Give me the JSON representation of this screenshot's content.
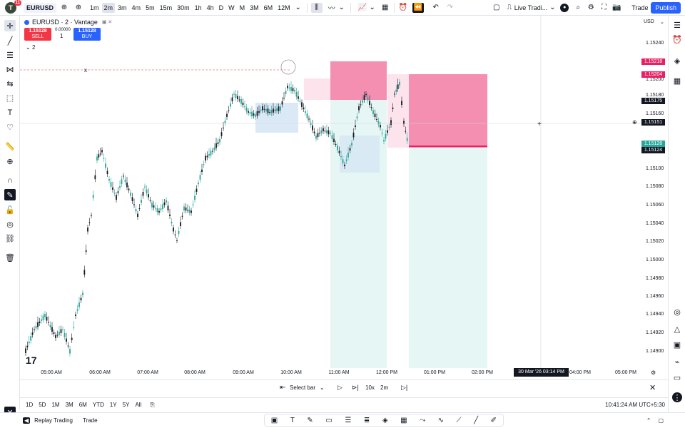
{
  "header": {
    "user_initial": "T",
    "notifications": "11",
    "symbol": "EURUSD",
    "intervals": [
      "1m",
      "2m",
      "3m",
      "4m",
      "5m",
      "15m",
      "30m",
      "1h",
      "4h",
      "D",
      "W",
      "M",
      "3M",
      "6M",
      "12M"
    ],
    "active_interval": "2m",
    "trading_label": "Live Tradi...",
    "trade_label": "Trade",
    "publish_label": "Publish"
  },
  "legend": {
    "symbol_line": "EURUSD · 2 · Vantage",
    "sell_price": "1.15128",
    "sell_label": "SELL",
    "buy_price": "1.15128",
    "buy_label": "BUY",
    "spread": "0.00000",
    "quantity": "1",
    "indicators_count": "2"
  },
  "axis": {
    "currency": "USD",
    "labels": [
      "1.15240",
      "1.15200",
      "1.15180",
      "1.15160",
      "1.15100",
      "1.15080",
      "1.15060",
      "1.15040",
      "1.15020",
      "1.15000",
      "1.14980",
      "1.14960",
      "1.14940",
      "1.14920",
      "1.14900"
    ],
    "tags": [
      {
        "text": "1.15218",
        "color": "#e91e63"
      },
      {
        "text": "1.15204",
        "color": "#e91e63"
      },
      {
        "text": "1.15175",
        "color": "#131722"
      },
      {
        "text": "1.15151",
        "color": "#131722"
      },
      {
        "text": "1.15128",
        "color": "#26a69a"
      },
      {
        "text": "1.15124",
        "color": "#131722"
      }
    ]
  },
  "time_axis": {
    "labels": [
      "05:00 AM",
      "06:00 AM",
      "07:00 AM",
      "08:00 AM",
      "09:00 AM",
      "10:00 AM",
      "11:00 AM",
      "12:00 PM",
      "01:00 PM",
      "02:00 PM",
      "04:00 PM",
      "05:00 PM"
    ],
    "crosshair_time": "30 Mar '26   03:14 PM"
  },
  "replay": {
    "select_bar": "Select bar",
    "speed": "10x",
    "interval": "2m"
  },
  "ranges": [
    "1D",
    "5D",
    "1M",
    "3M",
    "6M",
    "YTD",
    "1Y",
    "5Y",
    "All"
  ],
  "clock": "10:41:24 AM UTC+5:30",
  "bottom": {
    "replay_trading": "Replay Trading",
    "trade": "Trade"
  },
  "colors": {
    "up": "#26a69a",
    "down": "#131722",
    "risk_zone": "#f48fb1",
    "target_zone": "#e0f2f1",
    "accent": "#2962ff"
  }
}
